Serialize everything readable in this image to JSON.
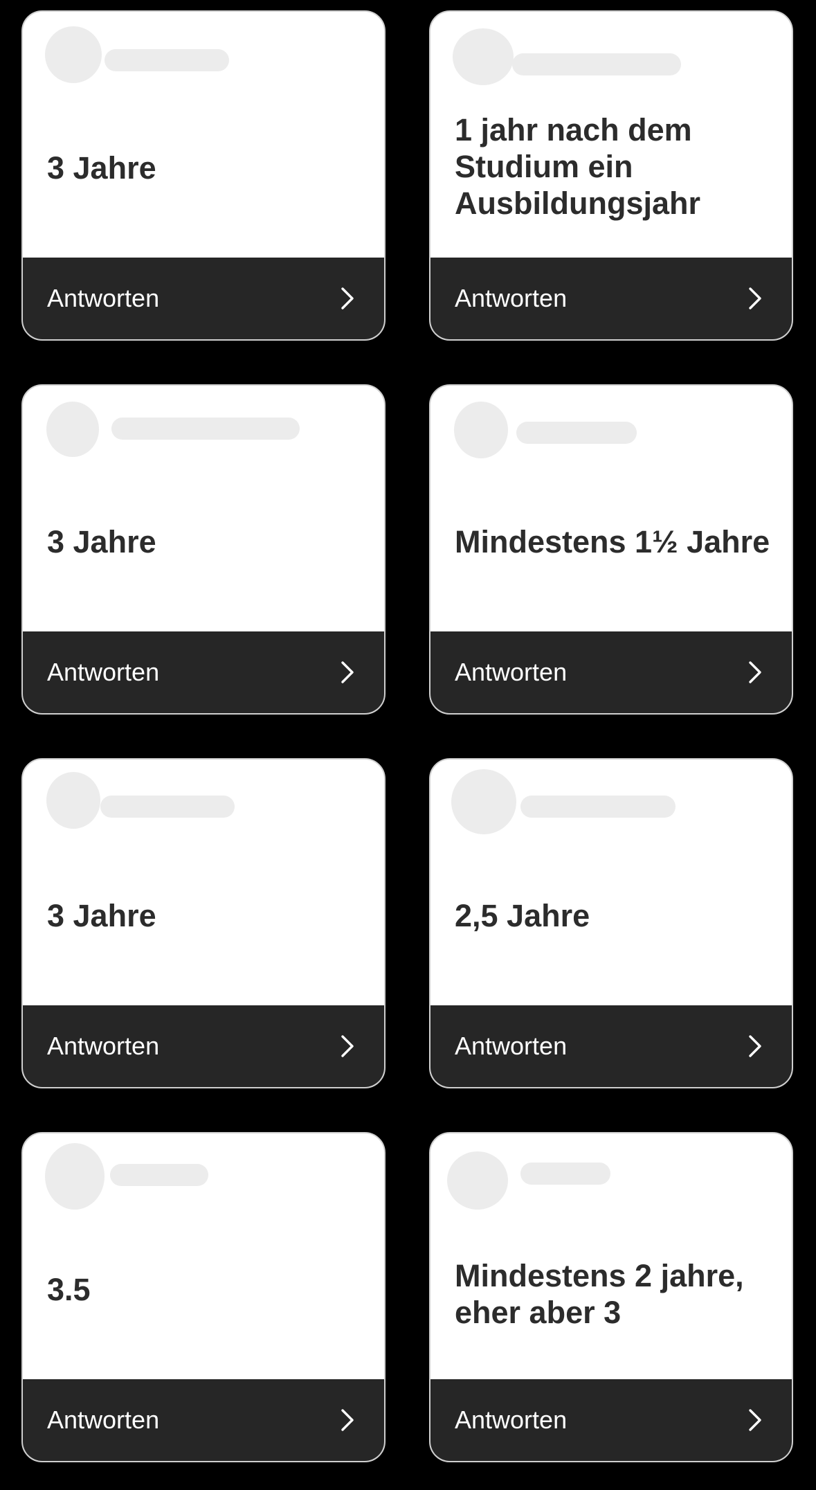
{
  "reply_label": "Antworten",
  "cards": [
    {
      "answer": "3 Jahre"
    },
    {
      "answer": "1 jahr nach dem Studium ein Ausbildungsjahr"
    },
    {
      "answer": "3 Jahre"
    },
    {
      "answer": "Mindestens 1½ Jahre"
    },
    {
      "answer": "3 Jahre"
    },
    {
      "answer": "2,5 Jahre"
    },
    {
      "answer": "3.5"
    },
    {
      "answer": "Mindestens 2 jahre, eher aber 3"
    }
  ],
  "icons": {
    "reply": "chevron-right-icon"
  },
  "colors": {
    "background": "#000000",
    "card": "#ffffff",
    "reply_bar": "#262626",
    "answer_text": "#2c2c2c",
    "redaction": "#ececec"
  }
}
